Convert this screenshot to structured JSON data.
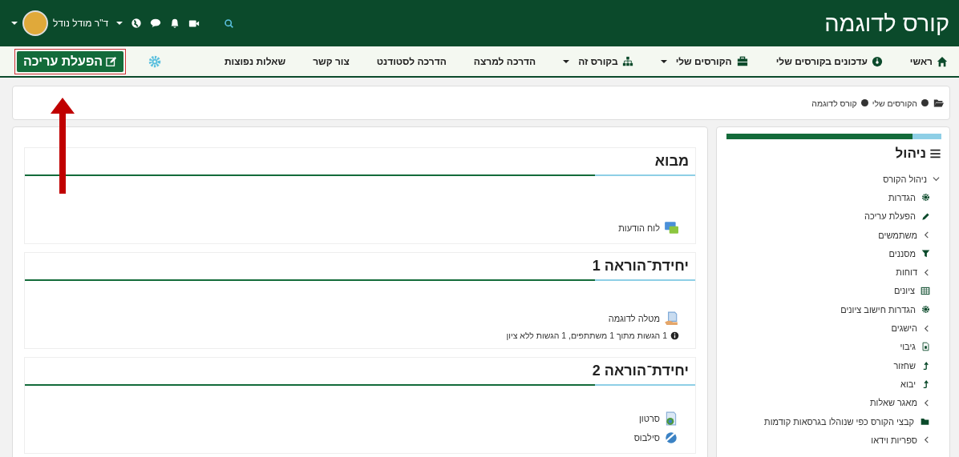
{
  "header": {
    "title": "קורס לדוגמה",
    "user": {
      "name": "ד\"ר מודל נודל"
    }
  },
  "nav": {
    "items": [
      {
        "label": "ראשי",
        "dropdown": false
      },
      {
        "label": "עדכונים בקורסים שלי",
        "dropdown": false
      },
      {
        "label": "הקורסים שלי",
        "dropdown": true
      },
      {
        "label": "בקורס זה",
        "dropdown": true
      },
      {
        "label": "הדרכה למרצה",
        "dropdown": false
      },
      {
        "label": "הדרכה לסטודנט",
        "dropdown": false
      },
      {
        "label": "צור קשר",
        "dropdown": false
      },
      {
        "label": "שאלות נפוצות",
        "dropdown": false
      }
    ],
    "edit_button": {
      "label": "הפעלת עריכה"
    }
  },
  "breadcrumb": [
    "הקורסים שלי",
    "קורס לדוגמה"
  ],
  "sections": [
    {
      "title": "מבוא",
      "activities": [
        {
          "kind": "forum",
          "label": "לוח הודעות"
        }
      ]
    },
    {
      "title": "יחידת־הוראה 1",
      "activities": [
        {
          "kind": "assign",
          "label": "מטלה לדוגמה",
          "note": "1 הגשות מתוך 1 משתתפים, 1 הגשות ללא ציון"
        }
      ]
    },
    {
      "title": "יחידת־הוראה 2",
      "activities": [
        {
          "kind": "video",
          "label": "סרטון"
        },
        {
          "kind": "url",
          "label": "סילבוס"
        }
      ]
    }
  ],
  "admin": {
    "title": "ניהול",
    "tree": [
      {
        "label": "ניהול הקורס",
        "kind": "branch",
        "expanded": true,
        "children": [
          {
            "label": "הגדרות",
            "kind": "leaf"
          },
          {
            "label": "הפעלת עריכה",
            "kind": "leaf"
          },
          {
            "label": "משתמשים",
            "kind": "branch",
            "expanded": false
          },
          {
            "label": "מסננים",
            "kind": "leaf"
          },
          {
            "label": "דוחות",
            "kind": "branch",
            "expanded": false
          },
          {
            "label": "ציונים",
            "kind": "leaf"
          },
          {
            "label": "הגדרות חישוב ציונים",
            "kind": "leaf"
          },
          {
            "label": "הישגים",
            "kind": "branch",
            "expanded": false
          },
          {
            "label": "גיבוי",
            "kind": "leaf"
          },
          {
            "label": "שחזור",
            "kind": "leaf"
          },
          {
            "label": "יבוא",
            "kind": "leaf"
          },
          {
            "label": "מאגר שאלות",
            "kind": "branch",
            "expanded": false
          },
          {
            "label": "קבצי הקורס כפי שנוהלו בגרסאות קודמות",
            "kind": "leaf"
          },
          {
            "label": "ספריות וידאו",
            "kind": "branch",
            "expanded": false
          }
        ]
      }
    ]
  }
}
